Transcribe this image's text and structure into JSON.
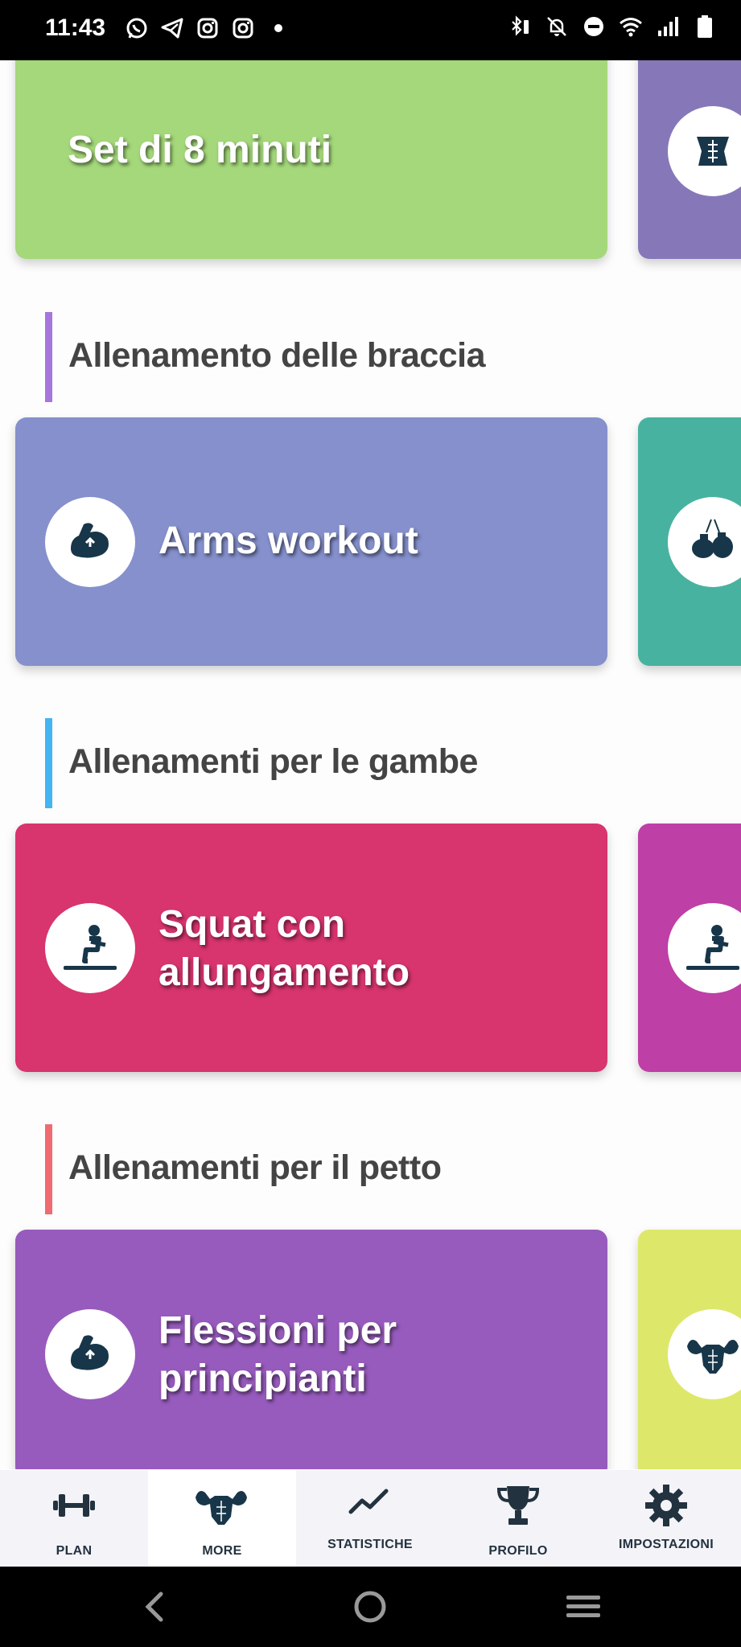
{
  "status_bar": {
    "time": "11:43",
    "left_icons": [
      "whatsapp-icon",
      "telegram-icon",
      "instagram-icon",
      "instagram-icon",
      "dot-icon"
    ],
    "right_icons": [
      "bluetooth-battery-icon",
      "bell-off-icon",
      "do-not-disturb-icon",
      "wifi-icon",
      "signal-icon",
      "battery-icon"
    ]
  },
  "sections": [
    {
      "cards": [
        {
          "title": "Set di 8 minuti",
          "color": "#a4d87a"
        },
        {
          "title": "",
          "color": "#8678b8",
          "icon": "abs-icon"
        }
      ]
    },
    {
      "header": "Allenamento delle braccia",
      "accent": "#a675dd",
      "cards": [
        {
          "title": "Arms workout",
          "color": "#8590cc",
          "icon": "biceps-icon"
        },
        {
          "title": "",
          "color": "#48b2a0",
          "icon": "boxing-gloves-icon"
        }
      ]
    },
    {
      "header": "Allenamenti per le gambe",
      "accent": "#43b5f3",
      "cards": [
        {
          "title_line1": "Squat con",
          "title_line2": "allungamento",
          "color": "#d8346e",
          "icon": "squat-icon"
        },
        {
          "title": "",
          "color": "#be3fa6",
          "icon": "squat-icon"
        }
      ]
    },
    {
      "header": "Allenamenti per il petto",
      "accent": "#f06a72",
      "cards": [
        {
          "title_line1": "Flessioni per",
          "title_line2": "principianti",
          "color": "#975bbd",
          "icon": "biceps-icon"
        },
        {
          "title": "",
          "color": "#dde86a",
          "icon": "bodybuilder-icon"
        }
      ]
    }
  ],
  "bottom_nav": {
    "items": [
      {
        "label": "PLAN",
        "icon": "dumbbell-icon",
        "active": false
      },
      {
        "label": "MORE",
        "icon": "bodybuilder-icon",
        "active": true
      },
      {
        "label": "STATISTICHE",
        "icon": "trend-line-icon",
        "active": false
      },
      {
        "label": "PROFILO",
        "icon": "trophy-icon",
        "active": false
      },
      {
        "label": "IMPOSTAZIONI",
        "icon": "gear-icon",
        "active": false
      }
    ]
  },
  "system_nav": [
    "back-icon",
    "home-icon",
    "recents-icon"
  ]
}
